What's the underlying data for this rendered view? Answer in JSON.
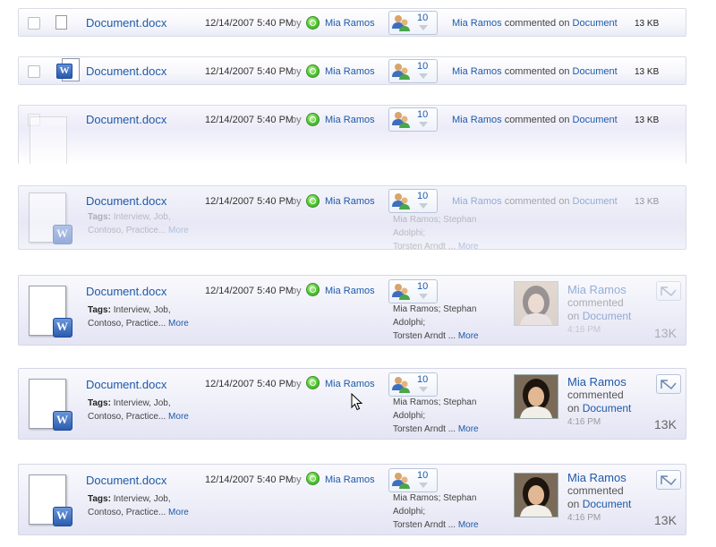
{
  "doc": {
    "title": "Document.docx",
    "date": "12/14/2007 5:40 PM",
    "by": "by",
    "author": "Mia Ramos",
    "share_count": "10",
    "activity_author": "Mia Ramos",
    "activity_text": "commented on",
    "activity_target": "Document",
    "size": "13 KB",
    "size_large": "13K",
    "tags_label": "Tags:",
    "tags_text": "Interview, Job, Contoso, Practice...",
    "tags_more": "More",
    "people_line1": "Mia Ramos;  Stephan Adolphi;",
    "people_line2": "Torsten Arndt ...",
    "people_more": "More",
    "panel_name": "Mia Ramos",
    "panel_line1": "commented",
    "panel_on": "on",
    "panel_target": "Document",
    "panel_time": "4:16 PM"
  },
  "icons": {
    "presence": "presence-online-icon",
    "people": "shared-people-icon",
    "word": "word-document-icon",
    "reply": "reply-icon",
    "cursor": "mouse-cursor-icon"
  },
  "colors": {
    "link": "#1e5aa8",
    "presence": "#3fbf2a",
    "word_blue": "#2b5cb0"
  }
}
